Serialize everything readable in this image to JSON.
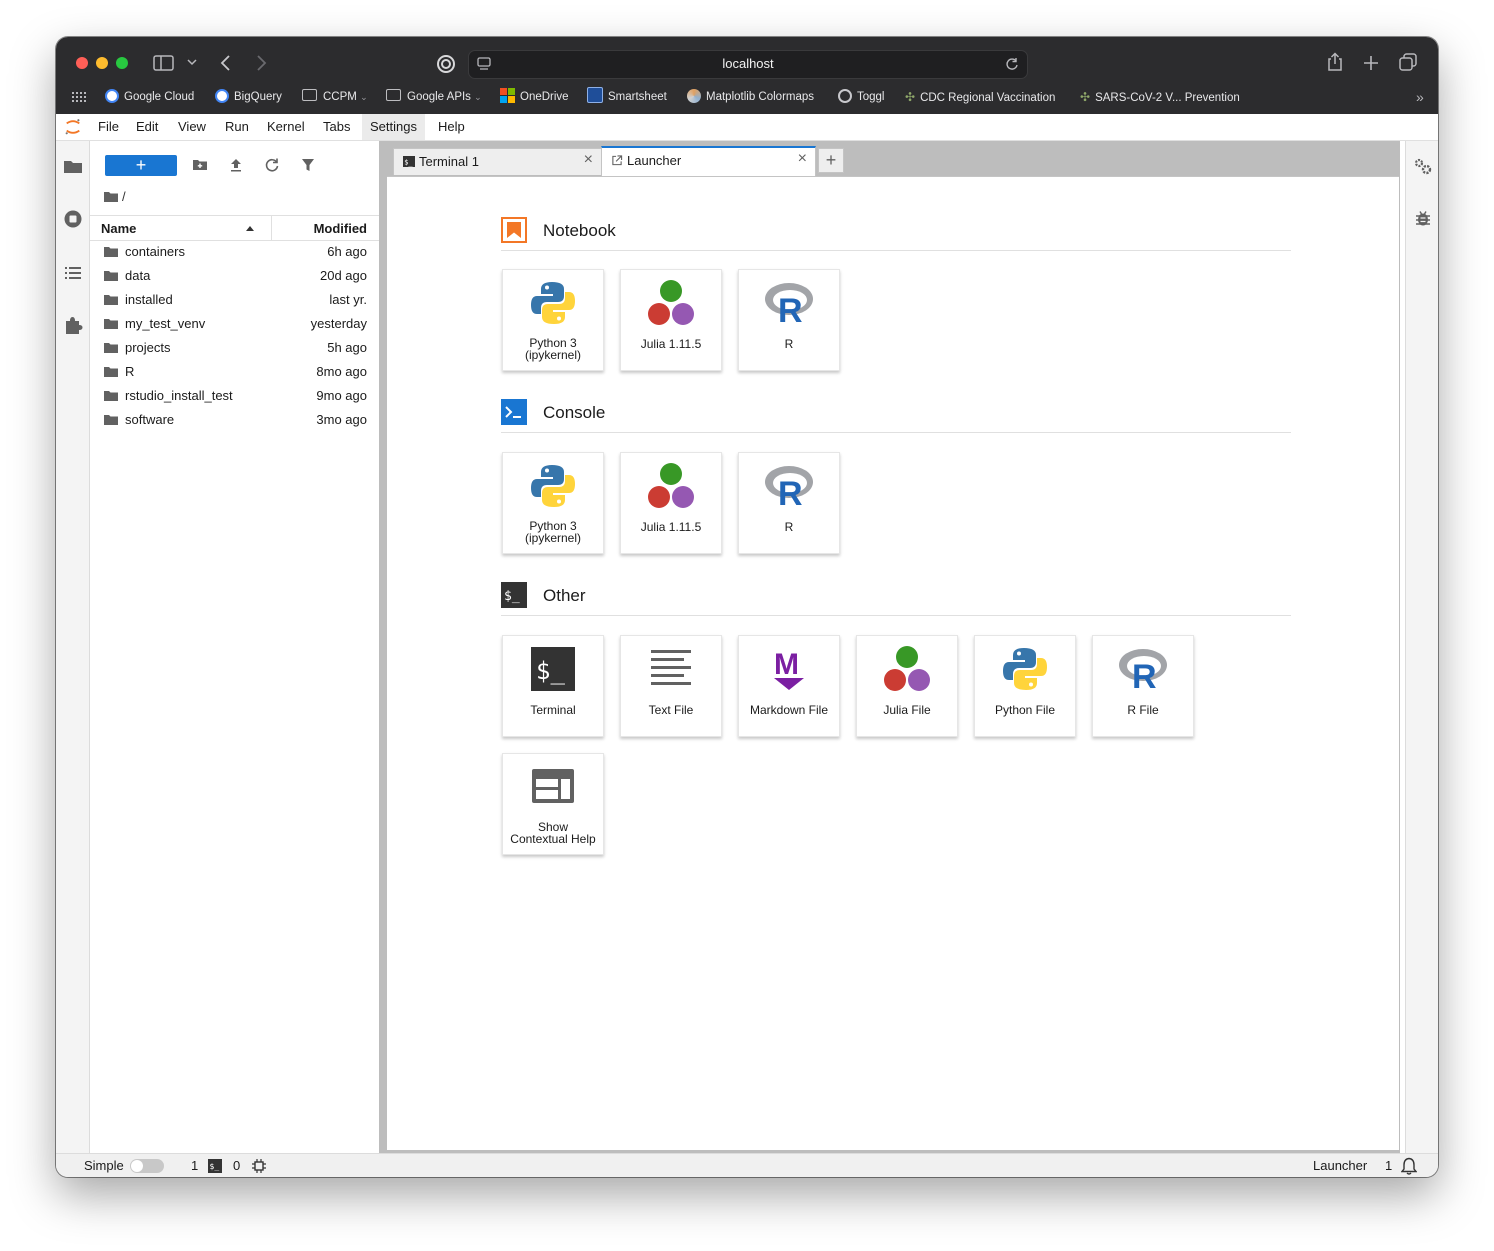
{
  "browser": {
    "url": "localhost",
    "favorites": [
      {
        "label": "Google Cloud",
        "icon": "google-icon"
      },
      {
        "label": "BigQuery",
        "icon": "google-icon"
      },
      {
        "label": "CCPM",
        "icon": "folder-icon"
      },
      {
        "label": "Google APIs",
        "icon": "folder-icon"
      },
      {
        "label": "OneDrive",
        "icon": "microsoft-icon"
      },
      {
        "label": "Smartsheet",
        "icon": "smartsheet-icon"
      },
      {
        "label": "Matplotlib Colormaps",
        "icon": "matplotlib-icon"
      },
      {
        "label": "Toggl",
        "icon": "toggl-icon"
      },
      {
        "label": "CDC Regional Vaccination",
        "icon": "tableau-icon"
      },
      {
        "label": "SARS-CoV-2 V... Prevention",
        "icon": "tableau-icon"
      }
    ]
  },
  "menubar": {
    "items": [
      "File",
      "Edit",
      "View",
      "Run",
      "Kernel",
      "Tabs",
      "Settings",
      "Help"
    ],
    "active": "Settings"
  },
  "filebrowser": {
    "new_label": "+",
    "breadcrumb": "/",
    "col_name": "Name",
    "col_modified": "Modified",
    "files": [
      {
        "name": "containers",
        "modified": "6h ago"
      },
      {
        "name": "data",
        "modified": "20d ago"
      },
      {
        "name": "installed",
        "modified": "last yr."
      },
      {
        "name": "my_test_venv",
        "modified": "yesterday"
      },
      {
        "name": "projects",
        "modified": "5h ago"
      },
      {
        "name": "R",
        "modified": "8mo ago"
      },
      {
        "name": "rstudio_install_test",
        "modified": "9mo ago"
      },
      {
        "name": "software",
        "modified": "3mo ago"
      }
    ]
  },
  "tabs": [
    {
      "label": "Terminal 1",
      "active": false
    },
    {
      "label": "Launcher",
      "active": true
    }
  ],
  "launcher": {
    "notebook": {
      "title": "Notebook",
      "cards": [
        "Python 3\n(ipykernel)",
        "Julia 1.11.5",
        "R"
      ]
    },
    "console": {
      "title": "Console",
      "cards": [
        "Python 3\n(ipykernel)",
        "Julia 1.11.5",
        "R"
      ]
    },
    "other": {
      "title": "Other",
      "cards": [
        "Terminal",
        "Text File",
        "Markdown File",
        "Julia File",
        "Python File",
        "R File",
        "Show\nContextual Help"
      ]
    }
  },
  "statusbar": {
    "mode_label": "Simple",
    "terminals": "1",
    "kernels": "0",
    "current": "Launcher",
    "notifications": "1"
  },
  "colors": {
    "accent": "#1976d2",
    "jupyter_orange": "#f37726",
    "julia_green": "#389826",
    "julia_red": "#cb3c33",
    "julia_purple": "#9558b2"
  }
}
